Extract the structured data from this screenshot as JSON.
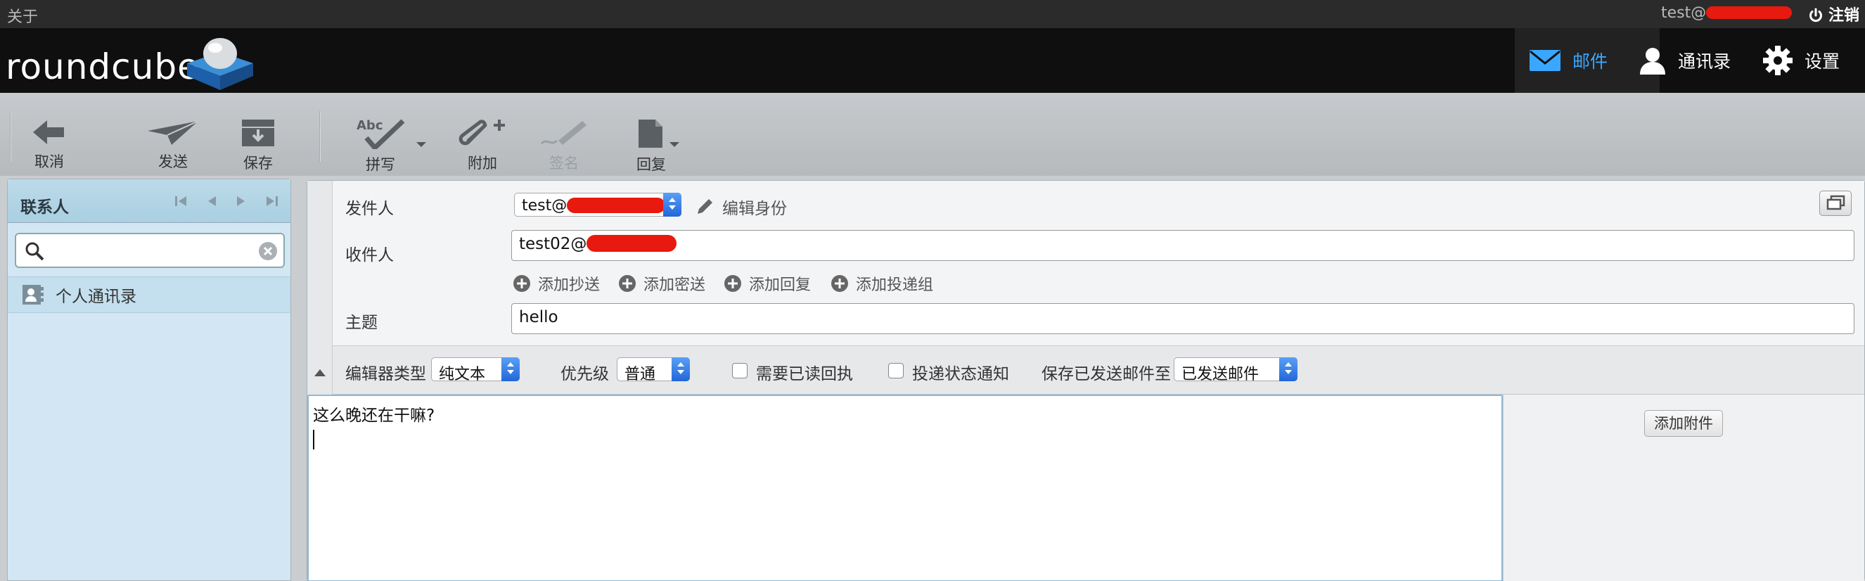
{
  "topbar": {
    "about": "关于",
    "user_prefix": "test@",
    "logout": "注销"
  },
  "header": {
    "logo_text": "roundcube",
    "nav": {
      "mail": "邮件",
      "contacts": "通讯录",
      "settings": "设置"
    },
    "accent": "#3aa7ff"
  },
  "toolbar": {
    "cancel": "取消",
    "send": "发送",
    "save": "保存",
    "spell": "拼写",
    "spell_icon_text": "Abc",
    "attach": "附加",
    "signature": "签名",
    "reply": "回复"
  },
  "contacts_panel": {
    "title": "联系人",
    "search_placeholder": "",
    "addressbook": "个人通讯录"
  },
  "compose": {
    "from_label": "发件人",
    "from_value_prefix": "test@",
    "edit_identity": "编辑身份",
    "to_label": "收件人",
    "to_value_prefix": "test02@",
    "add_cc": "添加抄送",
    "add_bcc": "添加密送",
    "add_reply": "添加回复",
    "add_followup": "添加投递组",
    "subject_label": "主题",
    "subject_value": "hello",
    "editor_type_label": "编辑器类型",
    "editor_type_value": "纯文本",
    "priority_label": "优先级",
    "priority_value": "普通",
    "read_receipt": "需要已读回执",
    "delivery_status": "投递状态通知",
    "save_sent_label": "保存已发送邮件至",
    "save_sent_value": "已发送邮件",
    "body": "这么晚还在干嘛?",
    "add_attachment": "添加附件"
  }
}
